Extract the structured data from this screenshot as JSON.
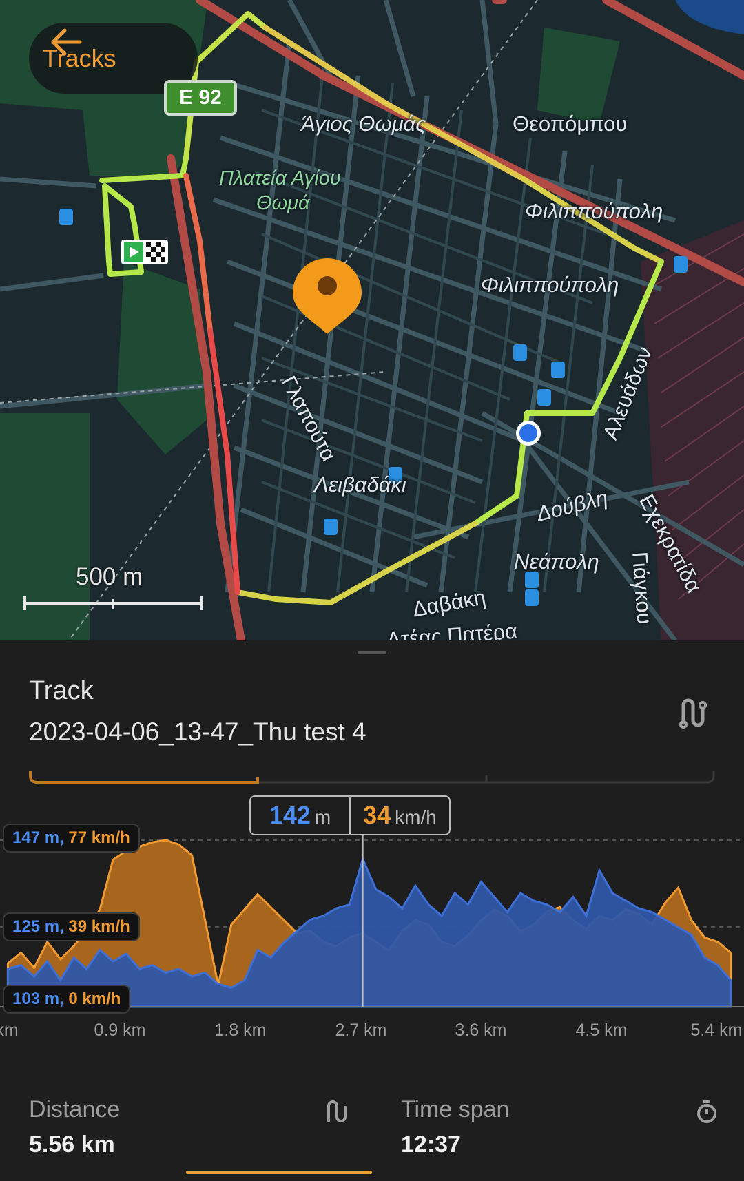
{
  "header": {
    "back_label": "Tracks"
  },
  "map": {
    "road_badge": "E 92",
    "scale_label": "500 m",
    "labels": {
      "agios_thomas": "Άγιος Θωμάς",
      "theopompou": "Θεοπόμπου",
      "plateia_line1": "Πλατεία Αγίου",
      "plateia_line2": "Θωμά",
      "filippoupoli_1": "Φιλιππούπολη",
      "filippoupoli_2": "Φιλιππούπολη",
      "glapouta": "Γλαπούτα",
      "alevadon": "Αλευάδων",
      "leivadaki": "Λειβαδάκι",
      "douvli": "Δούβλη",
      "neapoli": "Νεάπολη",
      "ekkratida": "Εχεκρατίδα",
      "giagkou": "Γιάγκου",
      "davaki": "Δαβάκη",
      "bottom_partial": "Ατέας Πατέρα"
    }
  },
  "track": {
    "section_title": "Track",
    "name": "2023-04-06_13-47_Thu test 4"
  },
  "chart_readout": {
    "altitude_value": "142",
    "altitude_unit": "m",
    "speed_value": "34",
    "speed_unit": "km/h"
  },
  "chart_data": {
    "type": "area",
    "y_chips": [
      {
        "alt": "147 m",
        "speed": "77 km/h"
      },
      {
        "alt": "125 m",
        "speed": "39 km/h"
      },
      {
        "alt": "103 m",
        "speed": "0 km/h"
      }
    ],
    "x_ticks": [
      "km",
      "0.9 km",
      "1.8 km",
      "2.7 km",
      "3.6 km",
      "4.5 km",
      "5.4 km"
    ],
    "x": [
      0,
      0.1,
      0.2,
      0.3,
      0.4,
      0.5,
      0.6,
      0.7,
      0.8,
      0.9,
      1.0,
      1.1,
      1.2,
      1.3,
      1.4,
      1.5,
      1.6,
      1.7,
      1.8,
      1.9,
      2.0,
      2.1,
      2.2,
      2.3,
      2.4,
      2.5,
      2.6,
      2.7,
      2.8,
      2.9,
      3.0,
      3.1,
      3.2,
      3.3,
      3.4,
      3.5,
      3.6,
      3.7,
      3.8,
      3.9,
      4.0,
      4.1,
      4.2,
      4.3,
      4.4,
      4.5,
      4.6,
      4.7,
      4.8,
      4.9,
      5.0,
      5.1,
      5.2,
      5.3,
      5.4,
      5.5
    ],
    "series": [
      {
        "name": "Altitude",
        "color": "#3d6fd6",
        "unit": "m",
        "ylim": [
          103,
          147
        ],
        "values": [
          113,
          114,
          111,
          115,
          110,
          116,
          113,
          118,
          115,
          117,
          113,
          114,
          112,
          113,
          111,
          112,
          109,
          108,
          110,
          118,
          116,
          120,
          123,
          126,
          127,
          129,
          130,
          142,
          134,
          132,
          129,
          135,
          130,
          127,
          133,
          130,
          136,
          132,
          128,
          133,
          131,
          130,
          128,
          132,
          127,
          139,
          133,
          131,
          129,
          128,
          126,
          124,
          122,
          116,
          114,
          110
        ]
      },
      {
        "name": "Speed",
        "color": "#f09a30",
        "unit": "km/h",
        "ylim": [
          0,
          77
        ],
        "values": [
          20,
          25,
          18,
          30,
          22,
          28,
          35,
          45,
          68,
          72,
          74,
          76,
          77,
          75,
          70,
          40,
          10,
          38,
          45,
          52,
          46,
          40,
          34,
          35,
          30,
          28,
          32,
          34,
          30,
          26,
          35,
          40,
          38,
          30,
          28,
          33,
          40,
          45,
          42,
          35,
          38,
          44,
          46,
          40,
          36,
          42,
          40,
          45,
          43,
          38,
          48,
          55,
          40,
          32,
          30,
          25
        ]
      }
    ]
  },
  "stats": {
    "distance_label": "Distance",
    "distance_value": "5.56 km",
    "timespan_label": "Time span",
    "timespan_value": "12:37"
  },
  "colors": {
    "accent": "#f29a32",
    "altitude": "#3d6fd6",
    "speed": "#f09a30"
  }
}
